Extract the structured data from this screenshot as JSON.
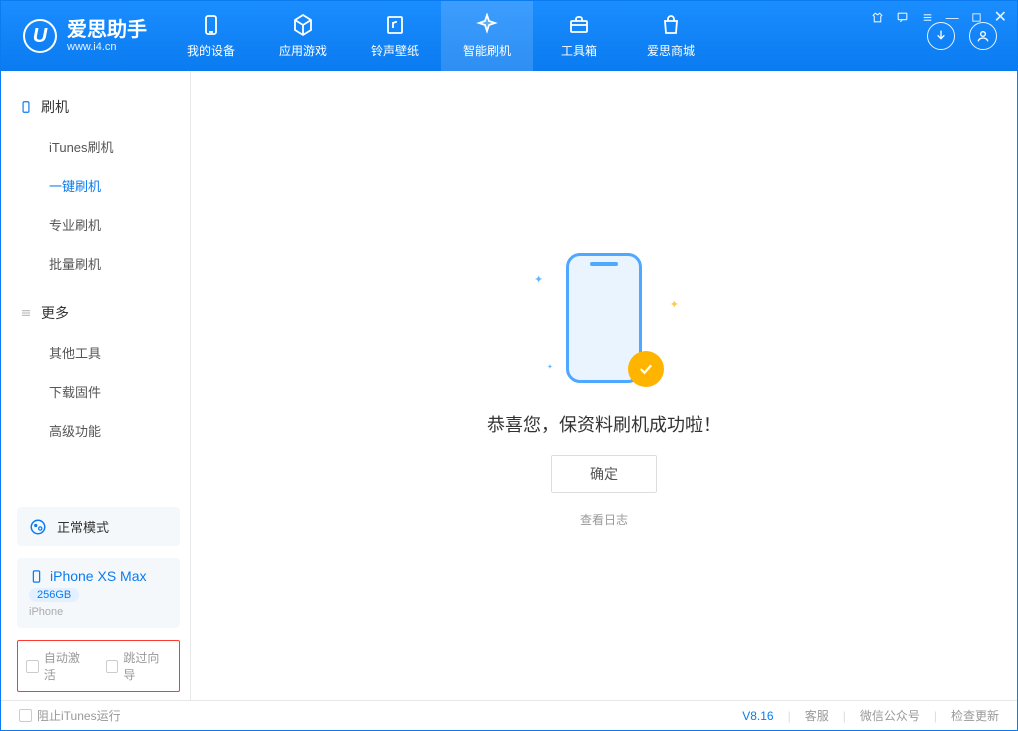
{
  "app": {
    "title": "爱思助手",
    "subtitle": "www.i4.cn"
  },
  "tabs": {
    "device": "我的设备",
    "apps": "应用游戏",
    "ringtones": "铃声壁纸",
    "flash": "智能刷机",
    "toolbox": "工具箱",
    "store": "爱思商城"
  },
  "sidebar": {
    "section_flash": "刷机",
    "items_flash": [
      "iTunes刷机",
      "一键刷机",
      "专业刷机",
      "批量刷机"
    ],
    "section_more": "更多",
    "items_more": [
      "其他工具",
      "下载固件",
      "高级功能"
    ],
    "mode_label": "正常模式",
    "device_name": "iPhone XS Max",
    "device_capacity": "256GB",
    "device_type": "iPhone",
    "opt_auto_activate": "自动激活",
    "opt_skip_guide": "跳过向导"
  },
  "main": {
    "success_msg": "恭喜您，保资料刷机成功啦！",
    "ok_button": "确定",
    "view_log": "查看日志"
  },
  "statusbar": {
    "block_itunes": "阻止iTunes运行",
    "version": "V8.16",
    "support": "客服",
    "wechat": "微信公众号",
    "check_update": "检查更新"
  }
}
